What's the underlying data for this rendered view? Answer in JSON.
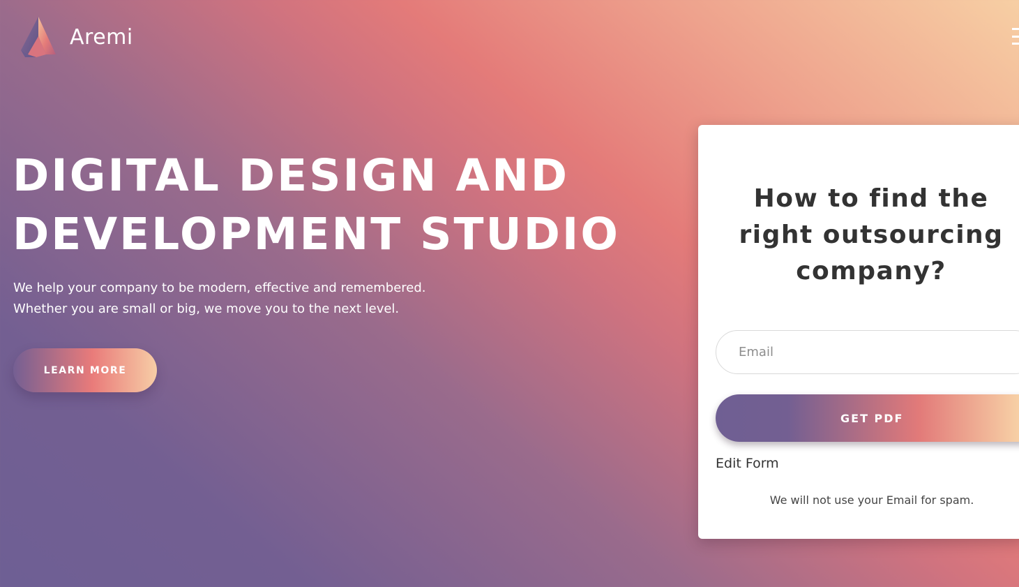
{
  "brand": {
    "name": "Aremi",
    "logo_icon": "aremi-logo-icon"
  },
  "nav": {
    "menu_icon": "hamburger-menu-icon"
  },
  "hero": {
    "title_lines": [
      "DIGITAL DESIGN AND",
      "DEVELOPMENT STUDIO"
    ],
    "subtitle_lines": [
      "We help your company to be modern, effective and remembered.",
      "Whether you are small or big, we move you to the next level."
    ],
    "cta_label": "LEARN MORE"
  },
  "form": {
    "title": "How to find the right outsourcing company?",
    "email_placeholder": "Email",
    "email_value": "",
    "submit_label": "GET PDF",
    "edit_label": "Edit Form",
    "disclaimer": "We will not use your Email for spam."
  },
  "colors": {
    "purple": "#735f92",
    "coral": "#e47b79",
    "peach": "#f7cfa4",
    "card_text": "#333333"
  }
}
